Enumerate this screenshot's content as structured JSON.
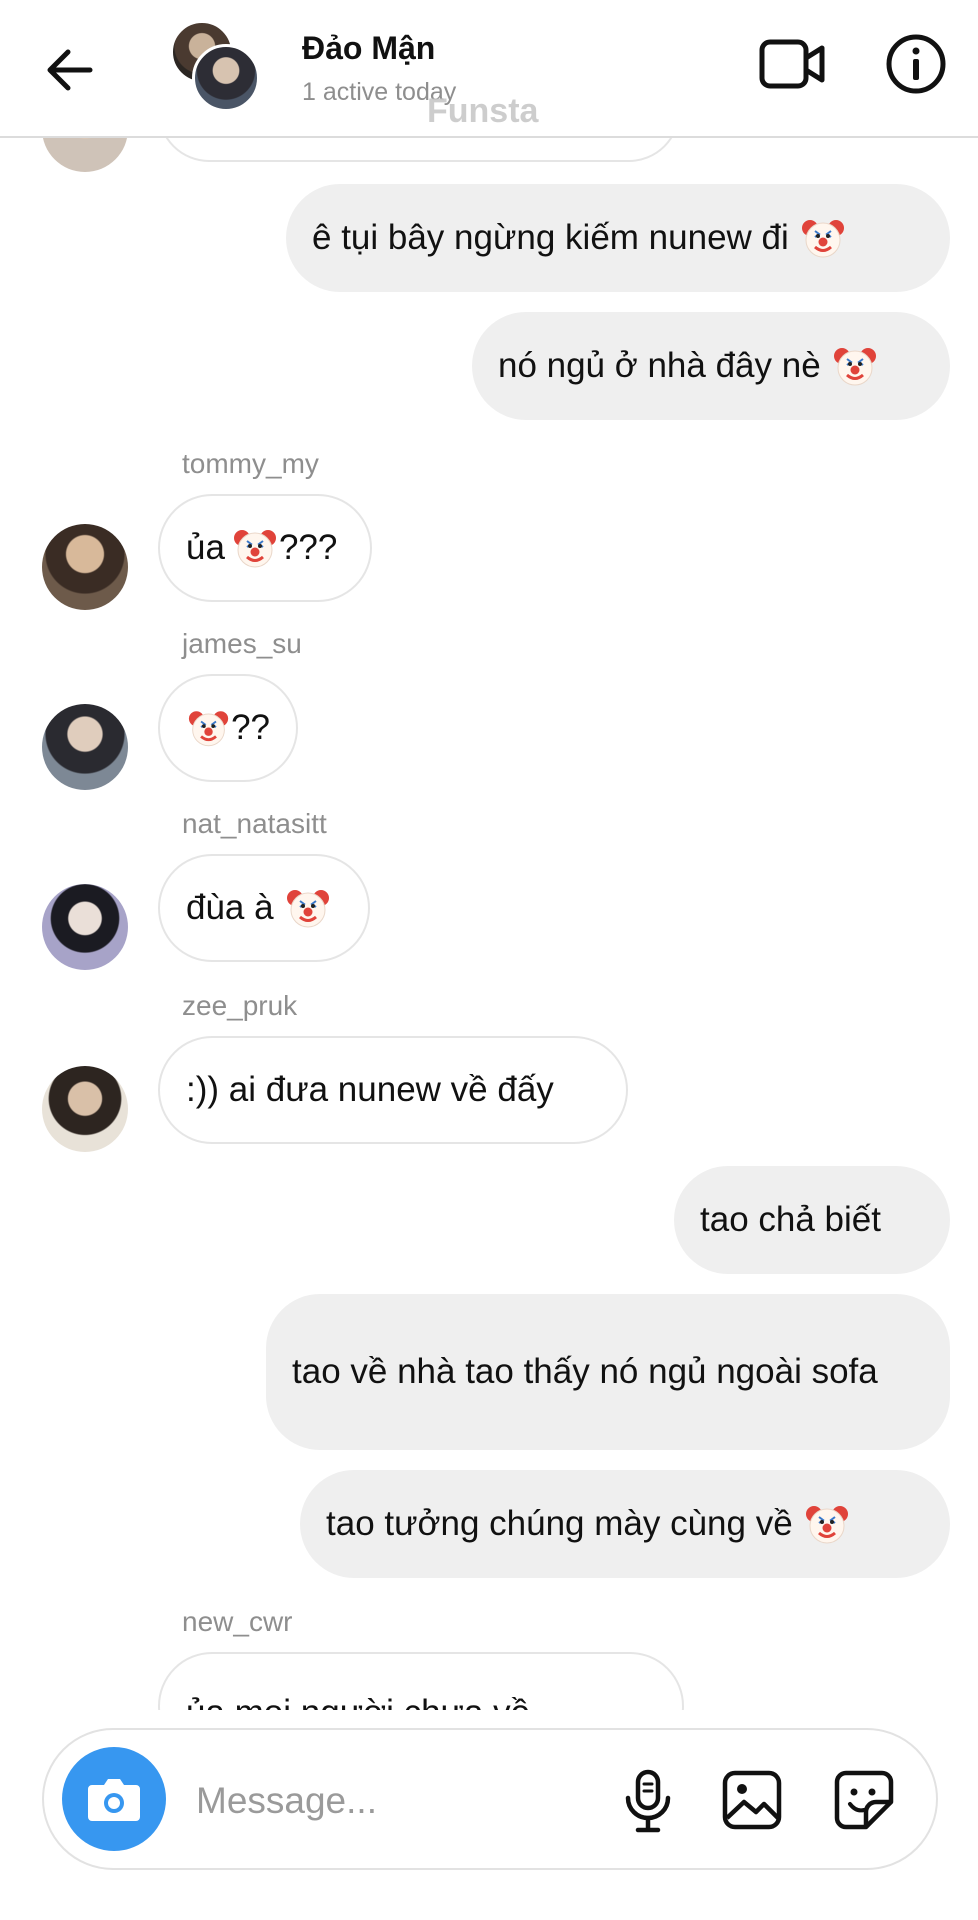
{
  "header": {
    "title": "Đảo Mận",
    "subtitle": "1 active today",
    "watermark": "Funsta"
  },
  "messages": {
    "m1": {
      "text": "ê tụi bây ngừng kiếm nunew đi"
    },
    "m2": {
      "text": "nó ngủ ở nhà đây nè"
    },
    "m3": {
      "sender": "tommy_my",
      "text_before": "ủa",
      "text_after": "???"
    },
    "m4": {
      "sender": "james_su",
      "text_after": "??"
    },
    "m5": {
      "sender": "nat_natasitt",
      "text": "đùa à"
    },
    "m6": {
      "sender": "zee_pruk",
      "text": ":)) ai đưa nunew về đấy"
    },
    "m7": {
      "text": "tao chả biết"
    },
    "m8": {
      "text": "tao về nhà tao thấy nó ngủ ngoài sofa"
    },
    "m9": {
      "text": "tao tưởng chúng mày cùng về"
    },
    "m10": {
      "sender": "new_cwr",
      "text": "ủa mọi người chưa về..."
    }
  },
  "composer": {
    "placeholder": "Message..."
  },
  "icons": {
    "back": "arrow-left-icon",
    "video": "video-camera-icon",
    "info": "info-icon",
    "camera": "camera-icon",
    "mic": "microphone-icon",
    "image": "image-icon",
    "sticker": "sticker-icon",
    "emoji": "clown-face-emoji"
  },
  "colors": {
    "accent": "#3797f0",
    "outgoing_bubble": "#efefef",
    "secondary_text": "#8e8e8e"
  }
}
